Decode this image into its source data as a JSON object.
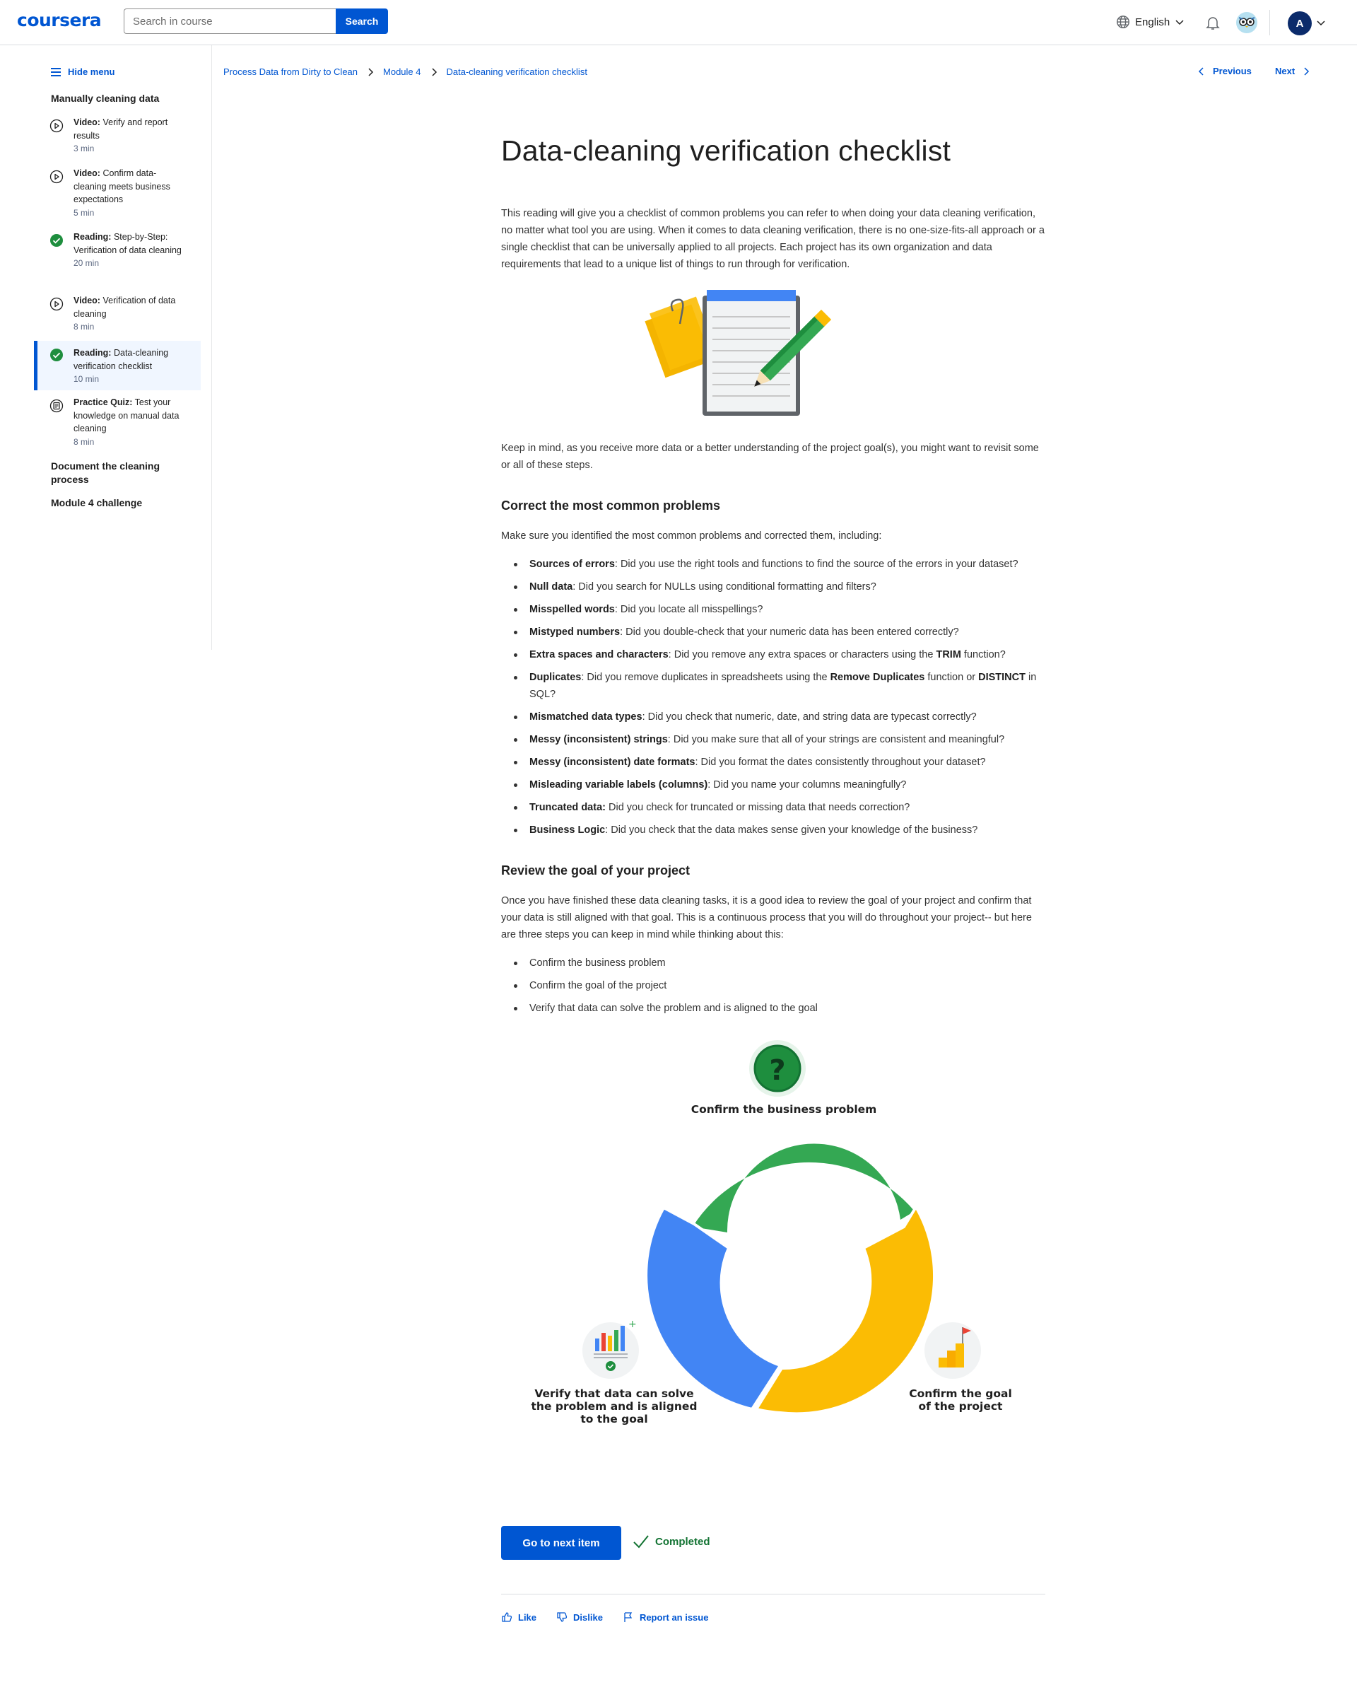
{
  "header": {
    "logo": "coursera",
    "search_placeholder": "Search in course",
    "search_button": "Search",
    "language": "English",
    "avatar_initial": "A"
  },
  "sidebar": {
    "hide_menu": "Hide menu",
    "section1": "Manually cleaning data",
    "items": [
      {
        "type": "Video:",
        "title": "Verify and report results",
        "meta": "3 min",
        "icon": "play-circle-icon"
      },
      {
        "type": "Video:",
        "title": "Confirm data-cleaning meets business expectations",
        "meta": "5 min",
        "icon": "play-circle-icon"
      },
      {
        "type": "Reading:",
        "title": "Step-by-Step: Verification of data cleaning",
        "meta": "20 min",
        "icon": "check-circle-icon"
      },
      {
        "type": "Video:",
        "title": "Verification of data cleaning",
        "meta": "8 min",
        "icon": "play-circle-icon"
      },
      {
        "type": "Reading:",
        "title": "Data-cleaning verification checklist",
        "meta": "10 min",
        "icon": "check-circle-icon"
      },
      {
        "type": "Practice Quiz:",
        "title": "Test your knowledge on manual data cleaning",
        "meta": "8 min",
        "icon": "quiz-icon"
      }
    ],
    "section2": "Document the cleaning process",
    "section3": "Module 4 challenge"
  },
  "breadcrumb": {
    "course": "Process Data from Dirty to Clean",
    "module": "Module 4",
    "page": "Data-cleaning verification checklist"
  },
  "nav": {
    "previous": "Previous",
    "next": "Next"
  },
  "content": {
    "title": "Data-cleaning verification checklist",
    "intro": "This reading will give you a checklist of common problems you can refer to when doing your data cleaning verification, no matter what tool you are using. When it comes to data cleaning verification, there is no one-size-fits-all approach or a single checklist that can be universally applied to all projects. Each project has its own organization and data requirements that lead to a unique list of things to run through for verification.",
    "keep_in_mind": "Keep in mind, as you receive more data or a better understanding of the project goal(s), you might want to revisit some or all of these steps.",
    "h_common": "Correct the most common problems",
    "make_sure": "Make sure you identified the most common problems and corrected them, including:",
    "problems": [
      {
        "term": "Sources of errors",
        "text": ": Did you use the right tools and functions to find the source of the errors in your dataset?"
      },
      {
        "term": "Null data",
        "text": ": Did you search for NULLs using conditional formatting and filters?"
      },
      {
        "term": "Misspelled words",
        "text": ": Did you locate all misspellings?"
      },
      {
        "term": "Mistyped numbers",
        "text": ": Did you double-check that your numeric data has been entered correctly?"
      },
      {
        "term": "Extra spaces and characters",
        "text": ": Did you remove any extra spaces or characters using the ",
        "bold2": "TRIM",
        "text2": " function?"
      },
      {
        "term": "Duplicates",
        "text": ": Did you remove duplicates in spreadsheets using the ",
        "bold2": "Remove Duplicates",
        "text2": " function or ",
        "bold3": "DISTINCT",
        "text3": " in SQL?"
      },
      {
        "term": "Mismatched data types",
        "text": ": Did you check that numeric, date, and string data are typecast correctly?"
      },
      {
        "term": "Messy (inconsistent) strings",
        "text": ": Did you make sure that all of your strings are consistent and meaningful?"
      },
      {
        "term": "Messy (inconsistent) date formats",
        "text": ": Did you format the dates consistently throughout your dataset?"
      },
      {
        "term": "Misleading variable labels (columns)",
        "text": ": Did you name your columns meaningfully?"
      },
      {
        "term": "Truncated data:",
        "text": " Did you check for truncated or missing data that needs correction?"
      },
      {
        "term": "Business Logic",
        "text": ": Did you check that the data makes sense given your knowledge of the business?"
      }
    ],
    "h_review": "Review the goal of your project",
    "review_para": "Once you have finished these data cleaning tasks, it is a good idea to review the goal of your project and confirm that your data is still aligned with that goal. This is a continuous process that you will do throughout your project-- but here are three steps you can keep in mind while thinking about this:",
    "steps": [
      "Confirm the business problem",
      "Confirm the goal of the project",
      "Verify that data can solve the problem and is aligned to the goal"
    ],
    "cycle_labels": {
      "top": "Confirm the business problem",
      "right_l1": "Confirm the goal",
      "right_l2": "of the project",
      "left_l1": "Verify that data can solve",
      "left_l2": "the problem and is aligned",
      "left_l3": "to the goal"
    },
    "cycle_colors": {
      "green": "#34a853",
      "yellow": "#fbbc04",
      "blue": "#4285f4"
    }
  },
  "footer": {
    "next_item": "Go to next item",
    "completed": "Completed",
    "like": "Like",
    "dislike": "Dislike",
    "report": "Report an issue"
  },
  "colors": {
    "brand": "#0056d2",
    "success": "#137333"
  }
}
